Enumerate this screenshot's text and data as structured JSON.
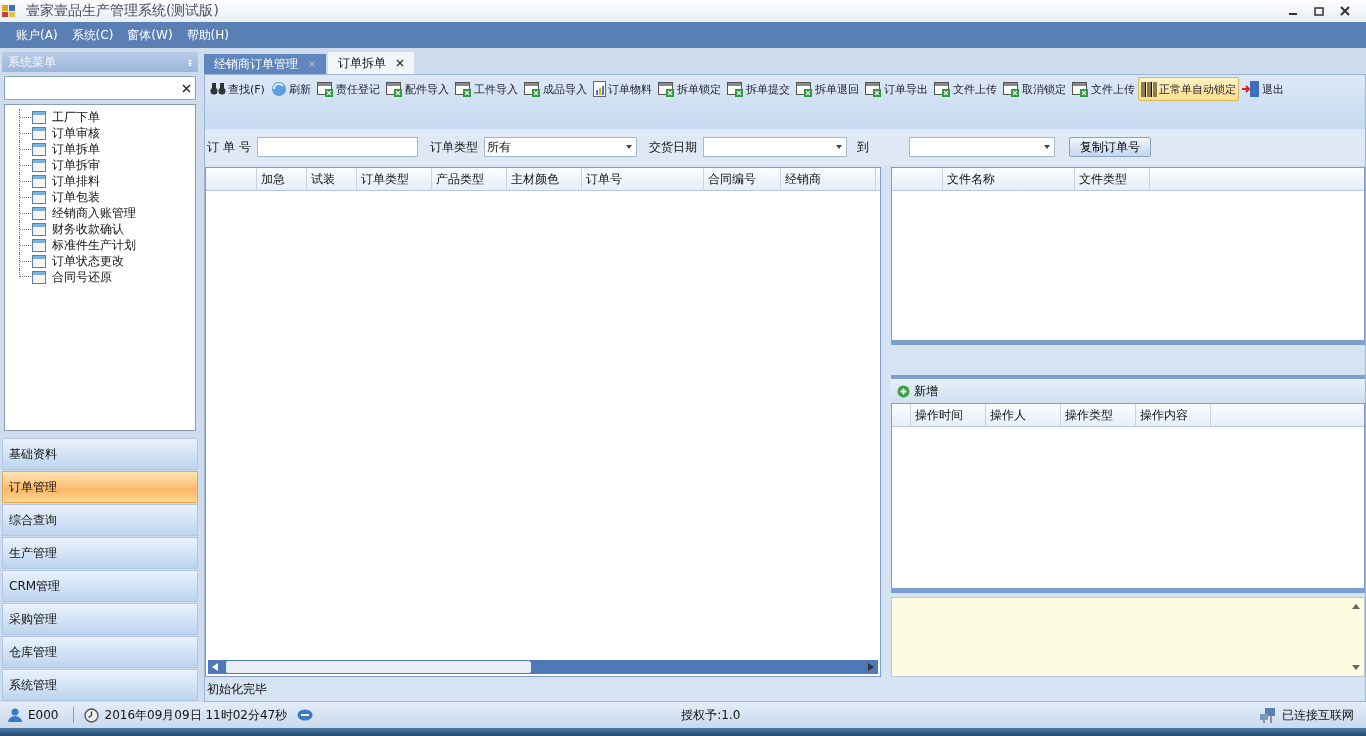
{
  "window": {
    "title": "壹家壹品生产管理系统(测试版)"
  },
  "menu": [
    "账户(A)",
    "系统(C)",
    "窗体(W)",
    "帮助(H)"
  ],
  "sidebar": {
    "title": "系统菜单",
    "pin": "ᵻ",
    "tree": [
      {
        "label": "工厂下单"
      },
      {
        "label": "订单审核"
      },
      {
        "label": "订单拆单"
      },
      {
        "label": "订单拆审"
      },
      {
        "label": "订单排料"
      },
      {
        "label": "订单包装"
      },
      {
        "label": "经销商入账管理"
      },
      {
        "label": "财务收款确认"
      },
      {
        "label": "标准件生产计划"
      },
      {
        "label": "订单状态更改"
      },
      {
        "label": "合同号还原"
      }
    ],
    "nav": [
      {
        "label": "基础资料",
        "selected": false
      },
      {
        "label": "订单管理",
        "selected": true
      },
      {
        "label": "综合查询",
        "selected": false
      },
      {
        "label": "生产管理",
        "selected": false
      },
      {
        "label": "CRM管理",
        "selected": false
      },
      {
        "label": "采购管理",
        "selected": false
      },
      {
        "label": "仓库管理",
        "selected": false
      },
      {
        "label": "系统管理",
        "selected": false
      }
    ]
  },
  "tabs": [
    {
      "label": "经销商订单管理",
      "selected": false
    },
    {
      "label": "订单拆单",
      "selected": true
    }
  ],
  "toolbar": [
    {
      "label": "查找(F)",
      "kind": "find",
      "selected": false
    },
    {
      "label": "刷新",
      "kind": "refresh",
      "selected": false
    },
    {
      "label": "责任登记",
      "kind": "sheet",
      "selected": false
    },
    {
      "label": "配件导入",
      "kind": "sheet",
      "selected": false
    },
    {
      "label": "工件导入",
      "kind": "sheet",
      "selected": false
    },
    {
      "label": "成品导入",
      "kind": "sheet",
      "selected": false
    },
    {
      "label": "订单物料",
      "kind": "report",
      "selected": false
    },
    {
      "label": "拆单锁定",
      "kind": "sheet",
      "selected": false
    },
    {
      "label": "拆单提交",
      "kind": "sheet",
      "selected": false
    },
    {
      "label": "拆单退回",
      "kind": "sheet",
      "selected": false
    },
    {
      "label": "订单导出",
      "kind": "sheet",
      "selected": false
    },
    {
      "label": "文件上传",
      "kind": "sheet",
      "selected": false
    },
    {
      "label": "取消锁定",
      "kind": "sheet",
      "selected": false
    },
    {
      "label": "文件上传",
      "kind": "sheet",
      "selected": false
    },
    {
      "label": "正常单自动锁定",
      "kind": "barcode",
      "selected": true
    },
    {
      "label": "退出",
      "kind": "exit",
      "selected": false
    }
  ],
  "filters": {
    "order_no": {
      "label": "订 单 号"
    },
    "order_type": {
      "label": "订单类型",
      "value": "所有"
    },
    "delivery_date": {
      "label": "交货日期"
    },
    "to": {
      "label": "到"
    },
    "copy_button": "复制订单号"
  },
  "orders_table": {
    "columns": [
      "加急",
      "试装",
      "订单类型",
      "产品类型",
      "主材颜色",
      "订单号",
      "合同编号",
      "经销商"
    ]
  },
  "files_table": {
    "columns": [
      "文件名称",
      "文件类型"
    ]
  },
  "add_button": "新增",
  "log_table": {
    "columns": [
      "操作时间",
      "操作人",
      "操作类型",
      "操作内容"
    ]
  },
  "status_message": "初始化完毕",
  "status_bar": {
    "user": "E000",
    "time": "2016年09月09日 11时02分47秒",
    "license": "授权予:1.0",
    "network": "已连接互联网"
  }
}
